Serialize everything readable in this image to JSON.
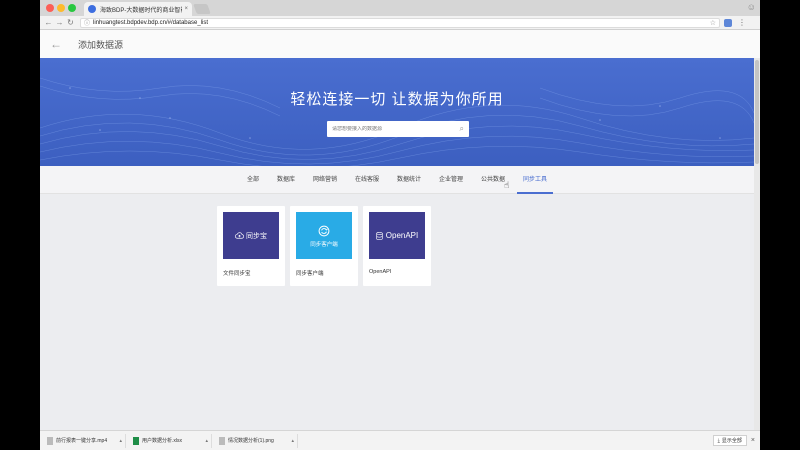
{
  "browser": {
    "tab_title": "海致BDP-大数据时代的商业智能",
    "tab_close": "×",
    "url": "linhuangtest.bdpdev.bdp.cn/#/database_list"
  },
  "page": {
    "title": "添加数据源",
    "back_arrow": "←"
  },
  "hero": {
    "headline": "轻松连接一切 让数据为你所用",
    "search_placeholder": "请您想要接入的数据源"
  },
  "categories": [
    {
      "label": "全部"
    },
    {
      "label": "数据库"
    },
    {
      "label": "网络营销"
    },
    {
      "label": "在线客服"
    },
    {
      "label": "数据统计"
    },
    {
      "label": "企业管理"
    },
    {
      "label": "公共数据"
    },
    {
      "label": "同步工具"
    }
  ],
  "active_category": "同步工具",
  "cards": [
    {
      "thumb_text": "同步宝",
      "label": "文件同步宝"
    },
    {
      "thumb_text": "同步客户端",
      "label": "同步客户端"
    },
    {
      "thumb_text": "OpenAPI",
      "label": "OpenAPI"
    }
  ],
  "downloads": [
    {
      "name": "前行报表一键分享.mp4"
    },
    {
      "name": "用户数据分析.xlsx"
    },
    {
      "name": "情况数据分析(1).png"
    }
  ],
  "download_bar": {
    "show_all": "显示全部",
    "close": "×"
  },
  "colors": {
    "hero": "#4a6ed0",
    "accent": "#4a6ed0",
    "card_dark": "#3e3d8f",
    "card_light": "#29abe6"
  }
}
